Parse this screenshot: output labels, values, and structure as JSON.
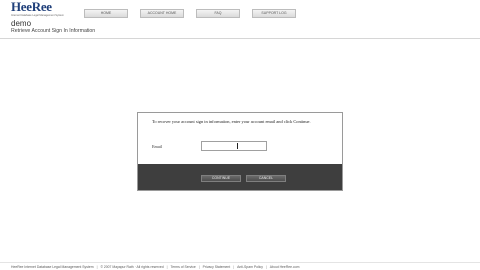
{
  "brand": {
    "logo_text": "HeeRee",
    "logo_tagline": "Internet Database Legal Management System",
    "logo_color": "#1f3f7a"
  },
  "nav": {
    "tabs": [
      {
        "label": "HOME"
      },
      {
        "label": "ACCOUNT HOME"
      },
      {
        "label": "FAQ"
      },
      {
        "label": "SUPPORT LOG"
      }
    ]
  },
  "header": {
    "user_name": "demo",
    "page_subtitle": "Retrieve Account Sign In Information"
  },
  "dialog": {
    "instructions": "To recover your account sign in information, enter your account email and click Continue.",
    "email_label": "Email",
    "email_value": "",
    "email_placeholder": "",
    "continue_label": "CONTINUE",
    "cancel_label": "CANCEL",
    "footer_color": "#3e3e3e"
  },
  "footer": {
    "product": "HeeRee Internet Database Legal Management System",
    "copyright": "© 2007 Mayapur Rath · All rights reserved",
    "links": [
      {
        "label": "Terms of Service"
      },
      {
        "label": "Privacy Statement"
      },
      {
        "label": "Anti-Spam Policy"
      },
      {
        "label": "About HeeRee.com"
      }
    ]
  }
}
